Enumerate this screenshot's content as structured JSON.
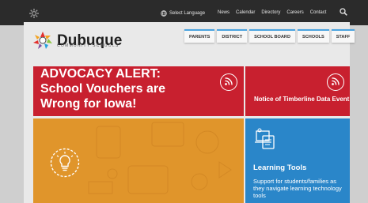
{
  "topbar": {
    "select_language": "Select Language",
    "links": [
      "News",
      "Calendar",
      "Directory",
      "Careers",
      "Contact"
    ]
  },
  "logo": {
    "name": "Dubuque",
    "subtitle": "COMMUNITY SCHOOLS"
  },
  "main_nav": [
    "PARENTS",
    "DISTRICT",
    "SCHOOL BOARD",
    "SCHOOLS",
    "STAFF"
  ],
  "cards": {
    "advocacy": {
      "title": "ADVOCACY ALERT: School Vouchers are Wrong for Iowa!"
    },
    "notice": {
      "title": "Notice of Timberline Data Event"
    },
    "learning_tools": {
      "title": "Learning Tools",
      "description": "Support for students/families as they navigate learning technology tools"
    }
  },
  "colors": {
    "red": "#c8202f",
    "orange": "#e0952b",
    "blue": "#2a86c9",
    "topbar": "#2b2b2b"
  }
}
